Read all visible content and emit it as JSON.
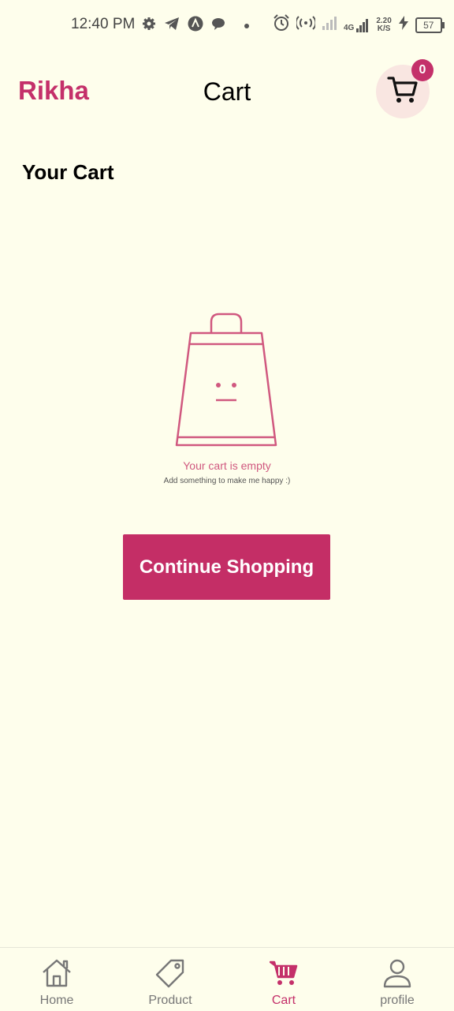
{
  "status_bar": {
    "time": "12:40 PM",
    "network_type": "4G",
    "speed_value": "2.20",
    "speed_unit": "K/S",
    "battery": "57"
  },
  "header": {
    "brand": "Rikha",
    "title": "Cart",
    "cart_count": "0"
  },
  "main": {
    "heading": "Your Cart",
    "empty_title": "Your cart is empty",
    "empty_subtitle": "Add something to make me happy :)",
    "continue_label": "Continue Shopping"
  },
  "bottom_nav": {
    "items": [
      {
        "label": "Home",
        "icon": "home-icon",
        "active": false
      },
      {
        "label": "Product",
        "icon": "tag-icon",
        "active": false
      },
      {
        "label": "Cart",
        "icon": "cart-icon",
        "active": true
      },
      {
        "label": "profile",
        "icon": "user-icon",
        "active": false
      }
    ]
  },
  "colors": {
    "accent": "#c4306a",
    "background": "#fefeec",
    "cart_button_bg": "#f9e6e1",
    "illustration": "#d0587f"
  }
}
